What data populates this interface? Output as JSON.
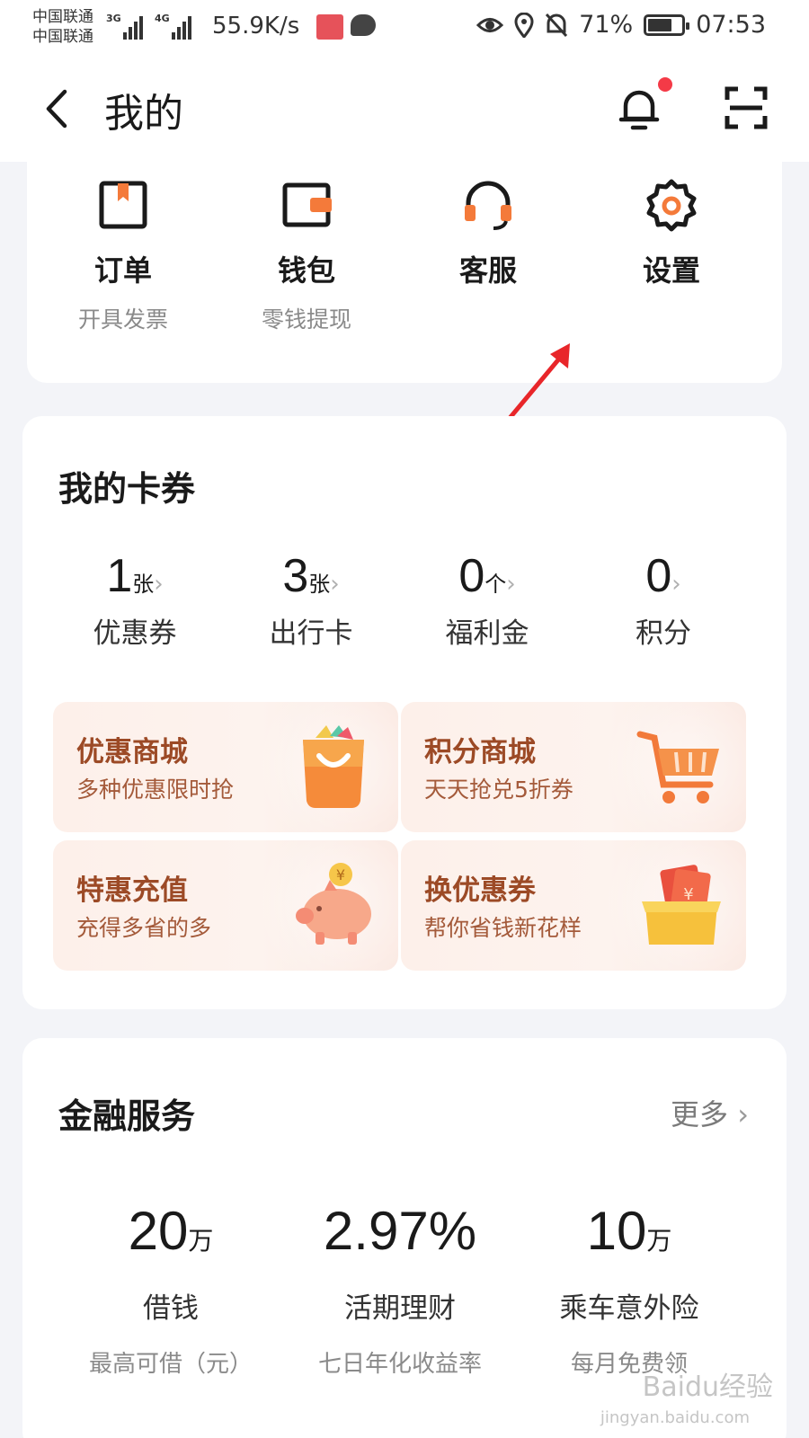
{
  "status": {
    "carrier1": "中国联通",
    "carrier2": "中国联通",
    "net1": "3G",
    "net2": "4G",
    "speed": "55.9K/s",
    "battery": "71%",
    "battery_level": 0.71,
    "time": "07:53"
  },
  "header": {
    "title": "我的"
  },
  "quick_actions": [
    {
      "label": "订单",
      "sub": "开具发票",
      "icon": "order-icon"
    },
    {
      "label": "钱包",
      "sub": "零钱提现",
      "icon": "wallet-icon"
    },
    {
      "label": "客服",
      "sub": "",
      "icon": "headset-icon"
    },
    {
      "label": "设置",
      "sub": "",
      "icon": "gear-icon"
    }
  ],
  "coupons": {
    "title": "我的卡券",
    "stats": [
      {
        "num": "1",
        "unit": "张",
        "label": "优惠券"
      },
      {
        "num": "3",
        "unit": "张",
        "label": "出行卡"
      },
      {
        "num": "0",
        "unit": "个",
        "label": "福利金"
      },
      {
        "num": "0",
        "unit": "",
        "label": "积分"
      }
    ],
    "promos": [
      {
        "title": "优惠商城",
        "sub": "多种优惠限时抢",
        "icon": "shopping-bag-icon"
      },
      {
        "title": "积分商城",
        "sub": "天天抢兑5折券",
        "icon": "cart-icon"
      },
      {
        "title": "特惠充值",
        "sub": "充得多省的多",
        "icon": "piggy-bank-icon"
      },
      {
        "title": "换优惠券",
        "sub": "帮你省钱新花样",
        "icon": "ticket-box-icon"
      }
    ]
  },
  "finance": {
    "title": "金融服务",
    "more": "更多",
    "items": [
      {
        "num": "20",
        "unit": "万",
        "label": "借钱",
        "sub": "最高可借（元）"
      },
      {
        "num": "2.97%",
        "unit": "",
        "label": "活期理财",
        "sub": "七日年化收益率"
      },
      {
        "num": "10",
        "unit": "万",
        "label": "乘车意外险",
        "sub": "每月免费领"
      }
    ]
  },
  "watermark": {
    "main": "Baidu经验",
    "sub": "jingyan.baidu.com"
  },
  "colors": {
    "accent": "#f47a3a",
    "promo_text": "#9c4a26",
    "annotation": "#e8262a",
    "dot": "#f43a47"
  }
}
